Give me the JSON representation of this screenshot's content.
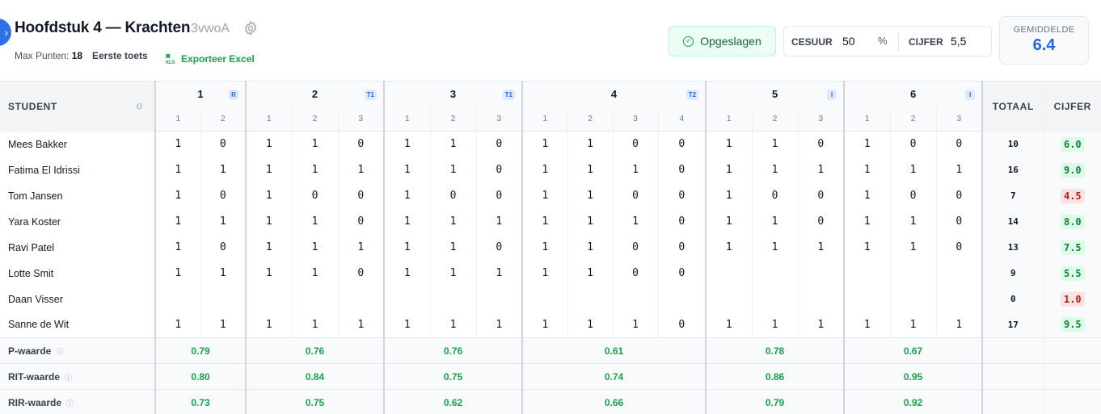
{
  "header": {
    "toggle_icon": "chevron-right-icon",
    "title": "Hoofdstuk 4 — Krachten",
    "class_code": "3vwoA",
    "max_points_label": "Max Punten:",
    "max_points_value": "18",
    "test_type": "Eerste toets",
    "export_label": "Exporteer Excel",
    "saved_label": "Opgeslagen",
    "cesuur_label": "CESUUR",
    "cesuur_value": "50",
    "cesuur_unit": "%",
    "cijfer_label": "CIJFER",
    "cijfer_value": "5,5",
    "average_label": "GEMIDDELDE",
    "average_value": "6.4"
  },
  "table": {
    "student_header": "STUDENT",
    "total_header": "TOTAAL",
    "grade_header": "CIJFER",
    "questions": [
      {
        "label": "1",
        "badge": "R",
        "subs": [
          "1",
          "2"
        ]
      },
      {
        "label": "2",
        "badge": "T1",
        "subs": [
          "1",
          "2",
          "3"
        ]
      },
      {
        "label": "3",
        "badge": "T1",
        "subs": [
          "1",
          "2",
          "3"
        ]
      },
      {
        "label": "4",
        "badge": "T2",
        "subs": [
          "1",
          "2",
          "3",
          "4"
        ]
      },
      {
        "label": "5",
        "badge": "I",
        "subs": [
          "1",
          "2",
          "3"
        ]
      },
      {
        "label": "6",
        "badge": "I",
        "subs": [
          "1",
          "2",
          "3"
        ]
      }
    ],
    "students": [
      {
        "name": "Mees Bakker",
        "scores": [
          "1",
          "0",
          "1",
          "1",
          "0",
          "1",
          "1",
          "0",
          "1",
          "1",
          "0",
          "0",
          "1",
          "1",
          "0",
          "1",
          "0",
          "0"
        ],
        "total": "10",
        "grade": "6.0",
        "pass": true
      },
      {
        "name": "Fatima El Idrissi",
        "scores": [
          "1",
          "1",
          "1",
          "1",
          "1",
          "1",
          "1",
          "0",
          "1",
          "1",
          "1",
          "0",
          "1",
          "1",
          "1",
          "1",
          "1",
          "1"
        ],
        "total": "16",
        "grade": "9.0",
        "pass": true
      },
      {
        "name": "Tom Jansen",
        "scores": [
          "1",
          "0",
          "1",
          "0",
          "0",
          "1",
          "0",
          "0",
          "1",
          "1",
          "0",
          "0",
          "1",
          "0",
          "0",
          "1",
          "0",
          "0"
        ],
        "total": "7",
        "grade": "4.5",
        "pass": false
      },
      {
        "name": "Yara Koster",
        "scores": [
          "1",
          "1",
          "1",
          "1",
          "0",
          "1",
          "1",
          "1",
          "1",
          "1",
          "1",
          "0",
          "1",
          "1",
          "0",
          "1",
          "1",
          "0"
        ],
        "total": "14",
        "grade": "8.0",
        "pass": true
      },
      {
        "name": "Ravi Patel",
        "scores": [
          "1",
          "0",
          "1",
          "1",
          "1",
          "1",
          "1",
          "0",
          "1",
          "1",
          "0",
          "0",
          "1",
          "1",
          "1",
          "1",
          "1",
          "0"
        ],
        "total": "13",
        "grade": "7.5",
        "pass": true
      },
      {
        "name": "Lotte Smit",
        "scores": [
          "1",
          "1",
          "1",
          "1",
          "0",
          "1",
          "1",
          "1",
          "1",
          "1",
          "0",
          "0",
          "",
          "",
          "",
          "",
          "",
          ""
        ],
        "total": "9",
        "grade": "5.5",
        "pass": true
      },
      {
        "name": "Daan Visser",
        "scores": [
          "",
          "",
          "",
          "",
          "",
          "",
          "",
          "",
          "",
          "",
          "",
          "",
          "",
          "",
          "",
          "",
          "",
          ""
        ],
        "total": "0",
        "grade": "1.0",
        "pass": false
      },
      {
        "name": "Sanne de Wit",
        "scores": [
          "1",
          "1",
          "1",
          "1",
          "1",
          "1",
          "1",
          "1",
          "1",
          "1",
          "1",
          "0",
          "1",
          "1",
          "1",
          "1",
          "1",
          "1"
        ],
        "total": "17",
        "grade": "9.5",
        "pass": true
      }
    ],
    "stats": [
      {
        "label": "P-waarde",
        "values": [
          "0.79",
          "0.76",
          "0.76",
          "0.61",
          "0.78",
          "0.67"
        ]
      },
      {
        "label": "RIT-waarde",
        "values": [
          "0.80",
          "0.84",
          "0.75",
          "0.74",
          "0.86",
          "0.95"
        ]
      },
      {
        "label": "RIR-waarde",
        "values": [
          "0.73",
          "0.75",
          "0.62",
          "0.66",
          "0.79",
          "0.92"
        ]
      }
    ]
  },
  "colors": {
    "accent": "#2563eb",
    "success": "#16a34a",
    "danger": "#b91c1c"
  }
}
